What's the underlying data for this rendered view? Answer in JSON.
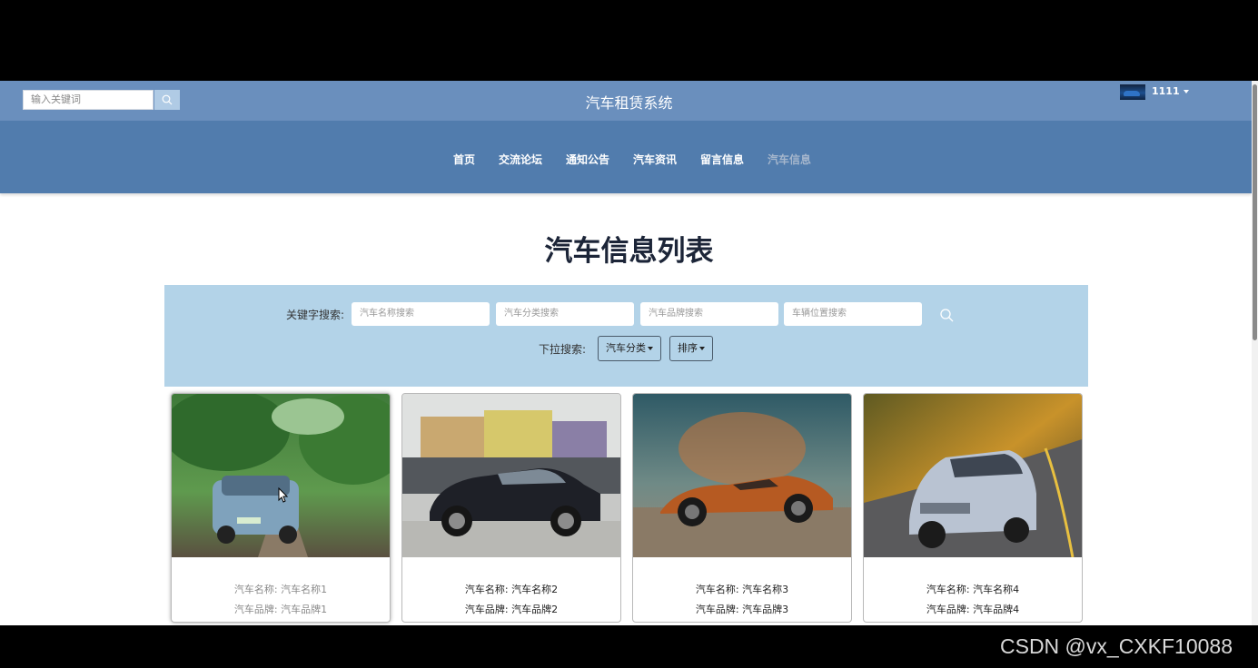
{
  "header": {
    "search_placeholder": "输入关键词",
    "site_title": "汽车租赁系统",
    "user_name": "1111"
  },
  "nav": {
    "items": [
      {
        "label": "首页"
      },
      {
        "label": "交流论坛"
      },
      {
        "label": "通知公告"
      },
      {
        "label": "汽车资讯"
      },
      {
        "label": "留言信息"
      },
      {
        "label": "汽车信息"
      }
    ],
    "active": "汽车信息"
  },
  "page": {
    "heading": "汽车信息列表"
  },
  "filter": {
    "keyword_label": "关键字搜索:",
    "name_placeholder": "汽车名称搜索",
    "category_placeholder": "汽车分类搜索",
    "brand_placeholder": "汽车品牌搜索",
    "location_placeholder": "车辆位置搜索",
    "dropdown_label": "下拉搜索:",
    "category_dropdown": "汽车分类",
    "sort_dropdown": "排序"
  },
  "cards": [
    {
      "name": "汽车名称: 汽车名称1",
      "brand": "汽车品牌: 汽车品牌1"
    },
    {
      "name": "汽车名称: 汽车名称2",
      "brand": "汽车品牌: 汽车品牌2"
    },
    {
      "name": "汽车名称: 汽车名称3",
      "brand": "汽车品牌: 汽车品牌3"
    },
    {
      "name": "汽车名称: 汽车名称4",
      "brand": "汽车品牌: 汽车品牌4"
    }
  ],
  "watermark": "CSDN @vx_CXKF10088",
  "colors": {
    "topbar": "#6a8fbd",
    "navbar": "#517cad",
    "filter_panel": "#b3d3e8",
    "heading": "#1c2538"
  }
}
